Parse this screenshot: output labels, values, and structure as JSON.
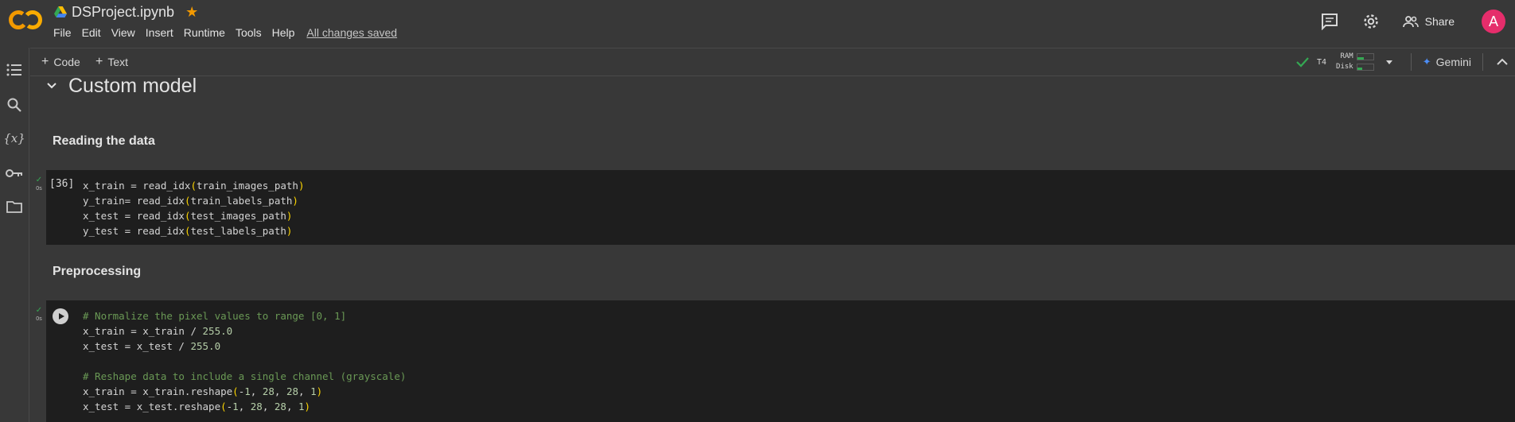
{
  "header": {
    "title": "DSProject.ipynb",
    "menu": [
      "File",
      "Edit",
      "View",
      "Insert",
      "Runtime",
      "Tools",
      "Help"
    ],
    "saved_status": "All changes saved",
    "share_label": "Share",
    "avatar_initial": "A"
  },
  "toolbar": {
    "add_code": "Code",
    "add_text": "Text",
    "runtime_type": "T4",
    "ram_label": "RAM",
    "disk_label": "Disk",
    "gemini_label": "Gemini"
  },
  "rail": {
    "icons": [
      "table-of-contents-icon",
      "search-icon",
      "variables-icon",
      "secrets-key-icon",
      "files-folder-icon"
    ]
  },
  "notebook": {
    "section_title": "Custom model",
    "text_cells": [
      "Reading the data",
      "Preprocessing"
    ],
    "cells": [
      {
        "exec_count": "[36]",
        "exec_time": "0s",
        "lines": [
          "x_train = read_idx(train_images_path)",
          "y_train= read_idx(train_labels_path)",
          "x_test = read_idx(test_images_path)",
          "y_test = read_idx(test_labels_path)"
        ]
      },
      {
        "exec_time": "0s",
        "lines": [
          "# Normalize the pixel values to range [0, 1]",
          "x_train = x_train / 255.0",
          "x_test = x_test / 255.0",
          "",
          "# Reshape data to include a single channel (grayscale)",
          "x_train = x_train.reshape(-1, 28, 28, 1)",
          "x_test = x_test.reshape(-1, 28, 28, 1)"
        ]
      }
    ]
  },
  "colors": {
    "background": "#383838",
    "cell_background": "#1e1e1e",
    "accent_orange": "#f29900",
    "check_green": "#34a853",
    "avatar_pink": "#e52d6b",
    "comment_green": "#6a9955",
    "paren_yellow": "#ffd700"
  }
}
